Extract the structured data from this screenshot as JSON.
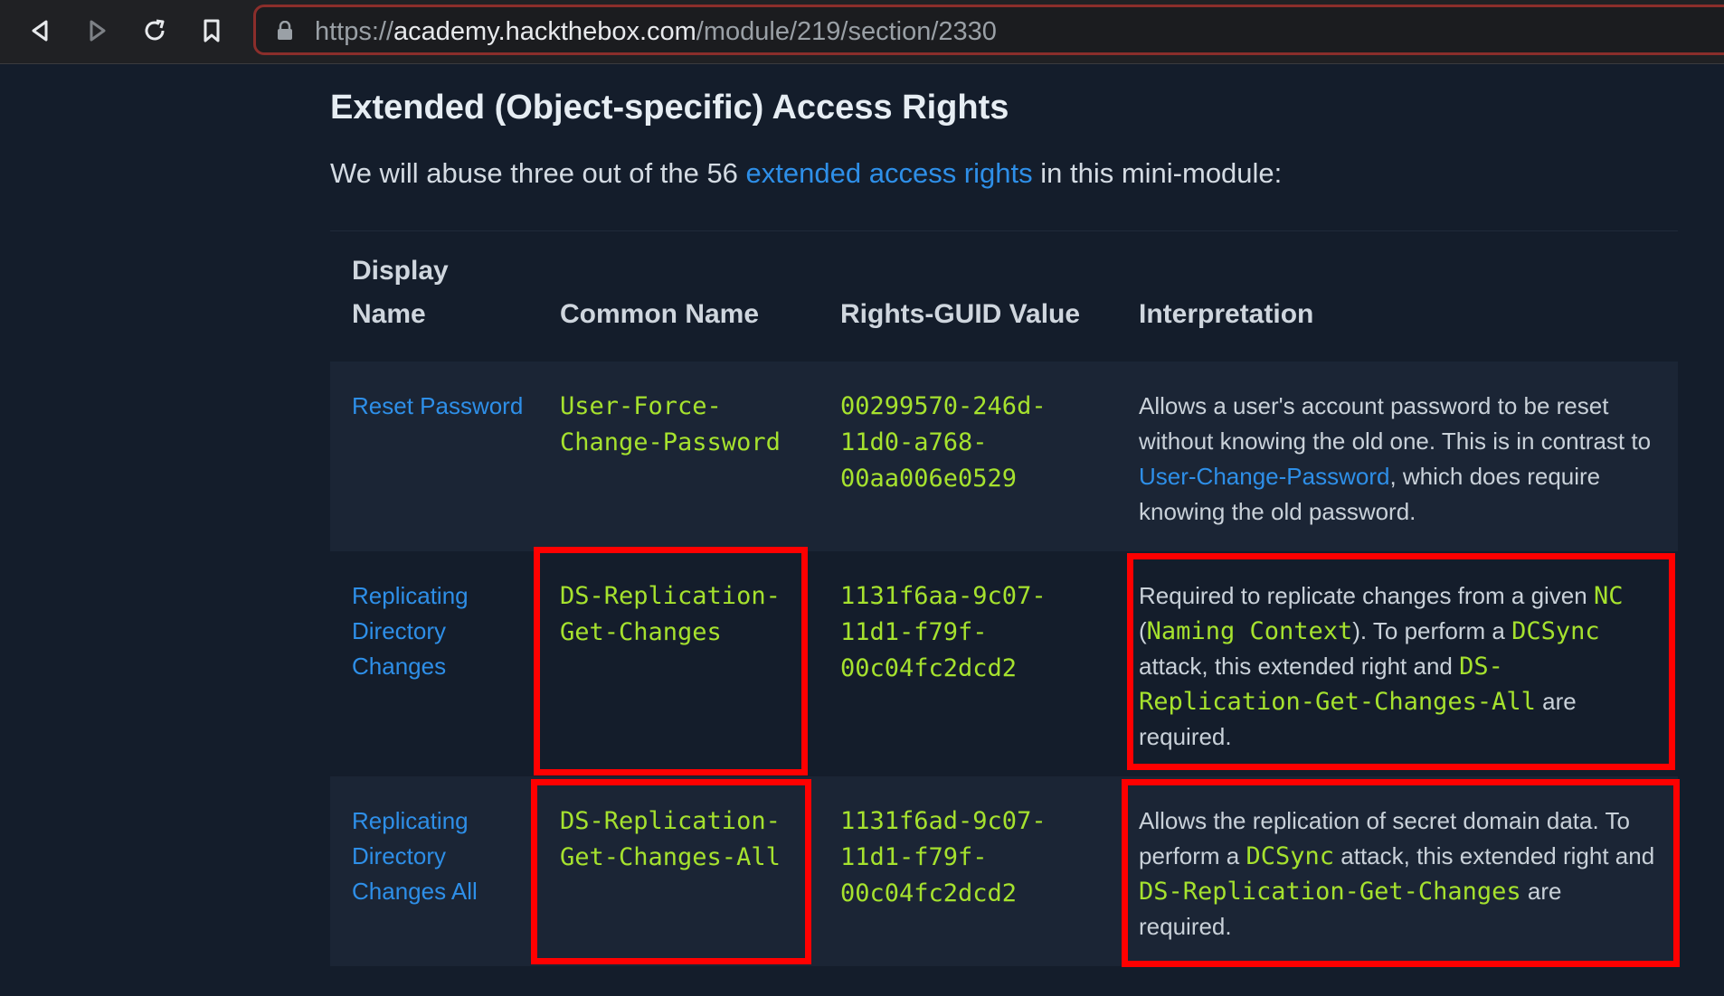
{
  "browser": {
    "url_prefix": "https://",
    "url_domain": "academy.hackthebox.com",
    "url_path": "/module/219/section/2330"
  },
  "page": {
    "heading": "Extended (Object-specific) Access Rights",
    "intro_before": "We will abuse three out of the 56 ",
    "intro_link": "extended access rights",
    "intro_after": " in this mini-module:"
  },
  "table": {
    "headers": [
      "Display Name",
      "Common Name",
      "Rights-GUID Value",
      "Interpretation"
    ],
    "rows": [
      {
        "display_name": "Reset Password",
        "common_name": "User-Force-Change-Password",
        "guid": "00299570-246d-11d0-a768-00aa006e0529",
        "interp": [
          {
            "t": "Allows a user's account password to be reset without knowing the old one. This is in contrast to "
          },
          {
            "t": "User-Change-Password",
            "link": true
          },
          {
            "t": ", which does require knowing the old password."
          }
        ]
      },
      {
        "display_name": "Replicating Directory Changes",
        "common_name": "DS-Replication-Get-Changes",
        "guid": "1131f6aa-9c07-11d1-f79f-00c04fc2dcd2",
        "interp": [
          {
            "t": "Required to replicate changes from a given "
          },
          {
            "t": "NC",
            "code": true
          },
          {
            "t": " ("
          },
          {
            "t": "Naming Context",
            "code": true
          },
          {
            "t": "). To perform a "
          },
          {
            "t": "DCSync",
            "code": true
          },
          {
            "t": " attack, this extended right and "
          },
          {
            "t": "DS-Replication-Get-Changes-All",
            "code": true
          },
          {
            "t": " are required."
          }
        ]
      },
      {
        "display_name": "Replicating Directory Changes All",
        "common_name": "DS-Replication-Get-Changes-All",
        "guid": "1131f6ad-9c07-11d1-f79f-00c04fc2dcd2",
        "interp": [
          {
            "t": "Allows the replication of secret domain data. To perform a "
          },
          {
            "t": "DCSync",
            "code": true
          },
          {
            "t": " attack, this extended right and "
          },
          {
            "t": "DS-Replication-Get-Changes",
            "code": true
          },
          {
            "t": " are required."
          }
        ]
      }
    ]
  },
  "colors": {
    "background": "#141d2b",
    "link": "#2e8fe8",
    "code": "#a6e22e",
    "highlight_box": "#ff0000"
  }
}
